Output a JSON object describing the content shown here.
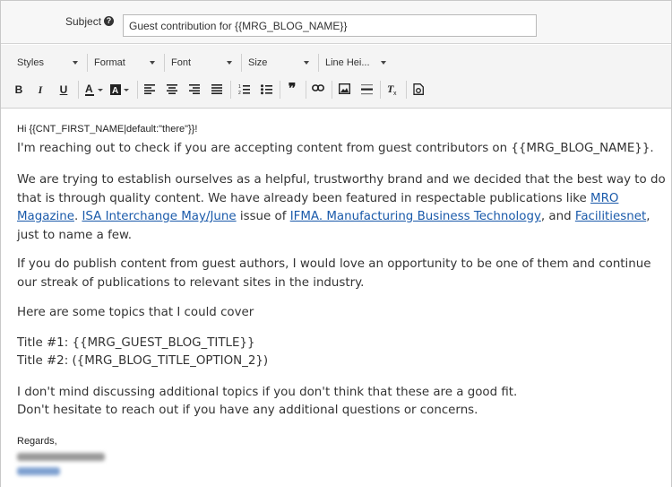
{
  "subject": {
    "label": "Subject",
    "value": "Guest contribution for {{MRG_BLOG_NAME}}"
  },
  "toolbar": {
    "styles": "Styles",
    "format": "Format",
    "font": "Font",
    "size": "Size",
    "line_height": "Line Hei...",
    "bold": "B",
    "italic": "I",
    "underline": "U",
    "text_color": "A",
    "bg_color": "A",
    "blockquote": "❞"
  },
  "email": {
    "greeting": "Hi {{CNT_FIRST_NAME|default:\"there\"}}!",
    "p1": "I'm reaching out to check if you are accepting content from guest contributors on {{MRG_BLOG_NAME}}.",
    "p2_a": "We are trying to establish ourselves as a helpful, trustworthy brand and we decided that the best way to do that is through quality content. We have already been featured in respectable publications like ",
    "p2_link1": "MRO Magazine",
    "p2_b": ". ",
    "p2_link2": "ISA Interchange May/June",
    "p2_c": " issue of ",
    "p2_link3": "IFMA. Manufacturing  Business Technology",
    "p2_d": ", and ",
    "p2_link4": "Facilitiesnet",
    "p2_e": ", just to name a few.",
    "p3": "If you do publish content from guest authors, I would love an opportunity to be one of them and continue our streak of publications to relevant sites in the industry.",
    "p4": "Here are some topics that I could cover",
    "title1": "Title #1: {{MRG_GUEST_BLOG_TITLE}}",
    "title2": "Title #2: ({MRG_BLOG_TITLE_OPTION_2})",
    "p5_line1": "I don't mind discussing additional topics if you don't think that these are a good fit.",
    "p5_line2": "Don't hesitate to reach out if you have any additional questions or concerns.",
    "regards": "Regards,"
  },
  "colors": {
    "link": "#1a5aaa",
    "toolbar_bg": "#f4f4f4"
  }
}
